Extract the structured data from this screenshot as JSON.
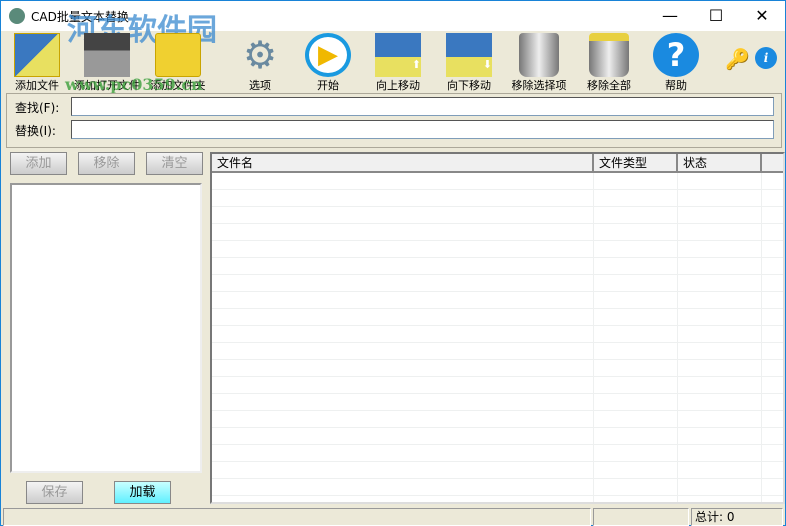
{
  "window": {
    "title": "CAD批量文本替换",
    "watermark": "河东软件园",
    "watermark_url": "www.pc0359.cn"
  },
  "toolbar": [
    {
      "label": "添加文件",
      "icon": "add-file-icon"
    },
    {
      "label": "添加打开文件",
      "icon": "add-open-file-icon"
    },
    {
      "label": "添加文件夹",
      "icon": "add-folder-icon"
    },
    {
      "label": "选项",
      "icon": "gear-icon"
    },
    {
      "label": "开始",
      "icon": "play-icon"
    },
    {
      "label": "向上移动",
      "icon": "move-up-icon"
    },
    {
      "label": "向下移动",
      "icon": "move-down-icon"
    },
    {
      "label": "移除选择项",
      "icon": "trash-icon"
    },
    {
      "label": "移除全部",
      "icon": "trash-all-icon"
    },
    {
      "label": "帮助",
      "icon": "help-icon"
    }
  ],
  "find": {
    "label": "查找(F):",
    "value": ""
  },
  "replace": {
    "label": "替换(I):",
    "value": ""
  },
  "left": {
    "add": "添加",
    "remove": "移除",
    "clear": "清空",
    "save": "保存",
    "load": "加载"
  },
  "columns": [
    "文件名",
    "文件类型",
    "状态"
  ],
  "status": {
    "total": "总计: 0"
  }
}
